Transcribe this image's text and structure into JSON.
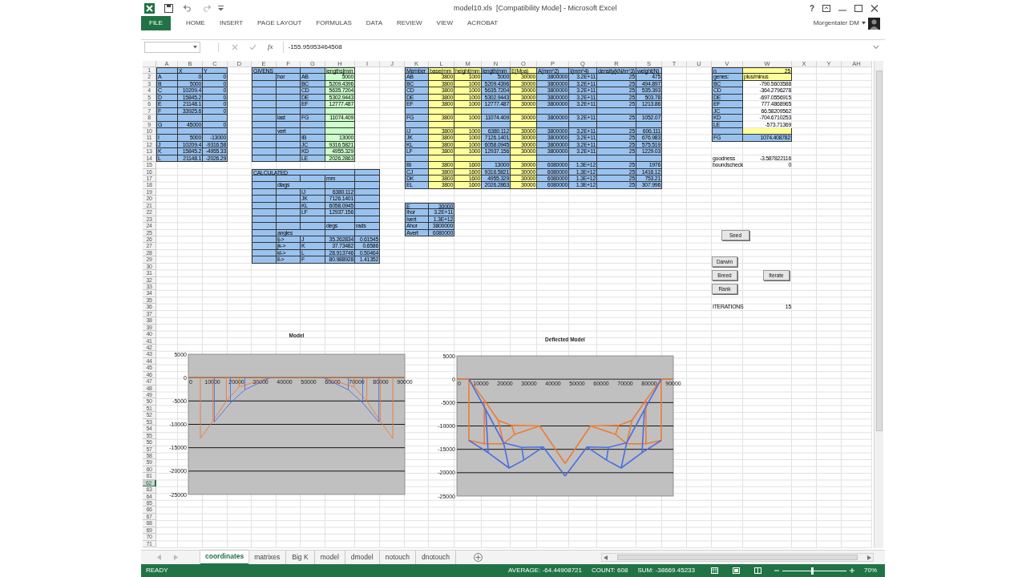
{
  "window": {
    "title": "model10.xls  [Compatibility Mode] - Microsoft Excel",
    "help": "?"
  },
  "ribbon": {
    "tabs": [
      {
        "label": "FILE",
        "kind": "file",
        "selected": false
      },
      {
        "label": "HOME",
        "kind": "tab",
        "selected": false
      },
      {
        "label": "INSERT",
        "kind": "tab",
        "selected": false
      },
      {
        "label": "PAGE LAYOUT",
        "kind": "tab",
        "selected": false
      },
      {
        "label": "FORMULAS",
        "kind": "tab",
        "selected": false
      },
      {
        "label": "DATA",
        "kind": "tab",
        "selected": false
      },
      {
        "label": "REVIEW",
        "kind": "tab",
        "selected": false
      },
      {
        "label": "VIEW",
        "kind": "tab",
        "selected": false
      },
      {
        "label": "ACROBAT",
        "kind": "tab",
        "selected": false
      }
    ],
    "user": "Morgentaler DM"
  },
  "formula_bar": {
    "function_label": "fx",
    "value": "-155.95953464508"
  },
  "sheet": {
    "columns": [
      "A",
      "B",
      "C",
      "D",
      "E",
      "F",
      "G",
      "H",
      "I",
      "J",
      "K",
      "L",
      "M",
      "N",
      "O",
      "P",
      "Q",
      "R",
      "S",
      "T",
      "U",
      "V",
      "W",
      "X",
      "Y",
      "AH"
    ],
    "rows": [
      {
        "label": "1",
        "selected": false
      },
      {
        "label": "2",
        "selected": false
      },
      {
        "label": "3",
        "selected": false
      },
      {
        "label": "4",
        "selected": false
      },
      {
        "label": "5",
        "selected": false
      },
      {
        "label": "6",
        "selected": false
      },
      {
        "label": "7",
        "selected": false
      },
      {
        "label": "8",
        "selected": false
      },
      {
        "label": "9",
        "selected": false
      },
      {
        "label": "10",
        "selected": false
      },
      {
        "label": "11",
        "selected": false
      },
      {
        "label": "12",
        "selected": false
      },
      {
        "label": "13",
        "selected": false
      },
      {
        "label": "14",
        "selected": false
      },
      {
        "label": "15",
        "selected": false
      },
      {
        "label": "16",
        "selected": false
      },
      {
        "label": "17",
        "selected": false
      },
      {
        "label": "18",
        "selected": false
      },
      {
        "label": "19",
        "selected": false
      },
      {
        "label": "20",
        "selected": false
      },
      {
        "label": "21",
        "selected": false
      },
      {
        "label": "22",
        "selected": false
      },
      {
        "label": "23",
        "selected": false
      },
      {
        "label": "24",
        "selected": false
      },
      {
        "label": "25",
        "selected": false
      },
      {
        "label": "26",
        "selected": false
      },
      {
        "label": "27",
        "selected": false
      },
      {
        "label": "28",
        "selected": false
      },
      {
        "label": "29",
        "selected": false
      },
      {
        "label": "30",
        "selected": false
      },
      {
        "label": "31",
        "selected": false
      },
      {
        "label": "32",
        "selected": false
      },
      {
        "label": "33",
        "selected": false
      },
      {
        "label": "34",
        "selected": false
      },
      {
        "label": "35",
        "selected": false
      },
      {
        "label": "36",
        "selected": false
      },
      {
        "label": "37",
        "selected": false
      },
      {
        "label": "38",
        "selected": false
      },
      {
        "label": "39",
        "selected": false
      },
      {
        "label": "40",
        "selected": false
      },
      {
        "label": "41",
        "selected": false
      },
      {
        "label": "42",
        "selected": false
      },
      {
        "label": "43",
        "selected": false
      },
      {
        "label": "44",
        "selected": false
      },
      {
        "label": "45",
        "selected": false
      },
      {
        "label": "46",
        "selected": false
      },
      {
        "label": "47",
        "selected": false
      },
      {
        "label": "48",
        "selected": false
      },
      {
        "label": "49",
        "selected": false
      },
      {
        "label": "50",
        "selected": false
      },
      {
        "label": "51",
        "selected": false
      },
      {
        "label": "52",
        "selected": false
      },
      {
        "label": "53",
        "selected": false
      },
      {
        "label": "54",
        "selected": false
      },
      {
        "label": "55",
        "selected": false
      },
      {
        "label": "56",
        "selected": false
      },
      {
        "label": "57",
        "selected": false
      },
      {
        "label": "58",
        "selected": false
      },
      {
        "label": "59",
        "selected": false
      },
      {
        "label": "60",
        "selected": false
      },
      {
        "label": "61",
        "selected": false
      },
      {
        "label": "62",
        "selected": true
      },
      {
        "label": "63",
        "selected": false
      },
      {
        "label": "64",
        "selected": false
      },
      {
        "label": "65",
        "selected": false
      },
      {
        "label": "66",
        "selected": false
      },
      {
        "label": "67",
        "selected": false
      },
      {
        "label": "68",
        "selected": false
      },
      {
        "label": "69",
        "selected": false
      },
      {
        "label": "70",
        "selected": false
      },
      {
        "label": "71",
        "selected": false
      }
    ],
    "blocks": [
      {
        "rows": [
          [
            "",
            {
              "text": "X",
              "kind": "label"
            },
            {
              "text": "Y",
              "kind": "label"
            }
          ],
          [
            "A",
            "0",
            "0"
          ],
          [
            "B",
            "5000",
            "0"
          ],
          [
            "C",
            "10209.4",
            "0"
          ],
          [
            "D",
            "15845.2",
            "0"
          ],
          [
            "E",
            "21148.1",
            "0"
          ],
          [
            "F",
            "33925.6",
            "0"
          ],
          [
            "",
            "",
            ""
          ],
          [
            "G",
            "45000",
            "0"
          ],
          [
            "",
            "",
            ""
          ],
          [
            "I",
            "5000",
            "-13000"
          ],
          [
            "J",
            "10209.4",
            "-9316.58"
          ],
          [
            "K",
            "15845.2",
            "-4955.33"
          ],
          [
            "L",
            "21148.1",
            "-2026.29"
          ]
        ]
      },
      {
        "rows": [
          [
            "GIVENS",
            "",
            "",
            {
              "text": "lengths[mm",
              "kind": "label"
            }
          ],
          [
            "",
            "hor",
            "AB",
            "5000"
          ],
          [
            "",
            "",
            "BC",
            "5209.4396"
          ],
          [
            "",
            "",
            "CD",
            "5635.7204"
          ],
          [
            "",
            "",
            "DE",
            "5302.9443"
          ],
          [
            "",
            "",
            "EF",
            "12777.487"
          ],
          [
            "",
            "",
            "",
            ""
          ],
          [
            "",
            "last",
            "FG",
            "11074.409"
          ],
          [
            "",
            "",
            "",
            ""
          ],
          [
            "",
            "vert",
            "",
            ""
          ],
          [
            "",
            "",
            "IB",
            "13000"
          ],
          [
            "",
            "",
            "JC",
            "9316.5821"
          ],
          [
            "",
            "",
            "KD",
            "4955.329"
          ],
          [
            "",
            "",
            "LE",
            "2026.2863"
          ]
        ]
      },
      {
        "rows": [
          [
            "CALCULATED",
            "",
            "",
            "",
            ""
          ],
          [
            "",
            "",
            "",
            {
              "text": "mm",
              "kind": "label"
            },
            ""
          ],
          [
            "",
            "diags",
            "",
            "",
            ""
          ],
          [
            "",
            "",
            "IJ",
            "6380.112",
            ""
          ],
          [
            "",
            "",
            "JK",
            "7126.1401",
            ""
          ],
          [
            "",
            "",
            "KL",
            "6058.0945",
            ""
          ],
          [
            "",
            "",
            "LF",
            "12937.156",
            ""
          ],
          [
            "",
            "",
            "",
            "",
            ""
          ],
          [
            "",
            "",
            "",
            {
              "text": "degs",
              "kind": "label"
            },
            {
              "text": "rads",
              "kind": "label"
            }
          ],
          [
            "",
            "angles",
            "",
            "",
            ""
          ],
          [
            "",
            "ij->",
            "J",
            "35.262834",
            "0.61545"
          ],
          [
            "",
            "jk->",
            "K",
            "37.73482",
            "0.6586"
          ],
          [
            "",
            "kl->",
            "L",
            "28.913746",
            "0.50464"
          ],
          [
            "",
            "ll->",
            "F",
            "80.988928",
            "1.41352"
          ]
        ]
      },
      {
        "rows": [
          [
            "Member",
            {
              "text": "base(mm",
              "kind": "label"
            },
            {
              "text": "height(mm",
              "kind": "label"
            },
            {
              "text": "length(mm",
              "kind": "label"
            },
            {
              "text": "E(Mpa)",
              "kind": "label"
            },
            {
              "text": "A(mm^2)",
              "kind": "label"
            },
            {
              "text": "I(mm^4)",
              "kind": "label"
            },
            {
              "text": "density(kN/m^3)",
              "kind": "label"
            },
            {
              "text": "weight(N)",
              "kind": "label"
            }
          ],
          [
            "AB",
            "3800",
            "1000",
            "5000",
            "30000",
            "3800000",
            "3.2E+11",
            "25",
            "475"
          ],
          [
            "BC",
            "3800",
            "1000",
            "5209.4396",
            "30000",
            "3800000",
            "3.2E+11",
            "25",
            "494.897"
          ],
          [
            "CD",
            "3800",
            "1000",
            "5635.7204",
            "30000",
            "3800000",
            "3.2E+11",
            "25",
            "535.393"
          ],
          [
            "DE",
            "3800",
            "1000",
            "5302.9443",
            "30000",
            "3800000",
            "3.2E+11",
            "25",
            "503.78"
          ],
          [
            "EF",
            "3800",
            "1000",
            "12777.487",
            "30000",
            "3800000",
            "3.2E+11",
            "25",
            "1213.86"
          ],
          [
            "",
            "",
            "",
            "",
            "",
            "",
            "",
            "",
            ""
          ],
          [
            "FG",
            "3800",
            "1000",
            "11074.409",
            "30000",
            "3800000",
            "3.2E+11",
            "25",
            "1052.07"
          ],
          [
            "",
            "",
            "",
            "",
            "",
            "",
            "",
            "",
            ""
          ],
          [
            "IJ",
            "3800",
            "1000",
            "6380.112",
            "30000",
            "3800000",
            "3.2E+11",
            "25",
            "606.111"
          ],
          [
            "JK",
            "3800",
            "1000",
            "7126.1401",
            "30000",
            "3800000",
            "3.2E+11",
            "25",
            "676.983"
          ],
          [
            "KL",
            "3800",
            "1000",
            "6058.0945",
            "30000",
            "3800000",
            "3.2E+11",
            "25",
            "575.519"
          ],
          [
            "LF",
            "3800",
            "1000",
            "12937.156",
            "30000",
            "3800000",
            "3.2E+11",
            "25",
            "1229.03"
          ],
          [
            "",
            "",
            "",
            "",
            "",
            "",
            "",
            "",
            ""
          ],
          [
            "BI",
            "3800",
            "1600",
            "13000",
            "30000",
            "6080000",
            "1.3E+12",
            "25",
            "1976"
          ],
          [
            "CJ",
            "3800",
            "1600",
            "9316.5821",
            "30000",
            "6080000",
            "1.3E+12",
            "25",
            "1416.12"
          ],
          [
            "DK",
            "3800",
            "1600",
            "4955.329",
            "30000",
            "6080000",
            "1.3E+12",
            "25",
            "753.21"
          ],
          [
            "EL",
            "3800",
            "1600",
            "2026.2863",
            "30000",
            "6080000",
            "1.3E+12",
            "25",
            "307.996"
          ]
        ]
      },
      {
        "rows": [
          [
            "E",
            "30000"
          ],
          [
            "Ihor",
            "3.2E+11"
          ],
          [
            "Ivert",
            "1.3E+12"
          ],
          [
            "Ahor",
            "3800000"
          ],
          [
            "Avert",
            "6080000"
          ]
        ]
      },
      {
        "rows": [
          [
            "n",
            {
              "text": "25",
              "color": "#ffff99"
            }
          ],
          [
            "genes:",
            {
              "text": "plus/minus",
              "color": "#ffff99",
              "kind": "label"
            }
          ],
          [
            "BC",
            "-790.5603588"
          ],
          [
            "CD",
            "-364.2796278"
          ],
          [
            "DE",
            "-697.0556915"
          ],
          [
            "EF",
            "777.4868965"
          ],
          [
            "JC",
            "66.58209562"
          ],
          [
            "KD",
            "-704.6710253"
          ],
          [
            "LE",
            "-573.71369"
          ],
          [
            "",
            {
              "text": "",
              "color": "#ffff99"
            }
          ],
          [
            "FG",
            {
              "text": "1074.408782",
              "color": "#99c2ef"
            }
          ]
        ]
      },
      {
        "rows": [
          [
            "goodness",
            "-3.587822116"
          ],
          [
            "boundscheck",
            "0"
          ]
        ]
      },
      {
        "rows": [
          [
            "ITERATIONS",
            "15"
          ]
        ]
      }
    ],
    "buttons": [
      {
        "label": "Seed"
      },
      {
        "label": "Darwin"
      },
      {
        "label": "Breed"
      },
      {
        "label": "Rank"
      },
      {
        "label": "Iterate"
      }
    ],
    "charts": [
      {
        "chart_data": {
          "type": "line",
          "title": "Model",
          "grid": true,
          "xlim": [
            0,
            90000
          ],
          "ylim": [
            -25000,
            5000
          ],
          "xticks": [
            0,
            10000,
            20000,
            30000,
            40000,
            50000,
            60000,
            70000,
            80000,
            90000
          ],
          "yticks": [
            5000,
            0,
            -5000,
            -10000,
            -15000,
            -20000,
            -25000
          ],
          "series": [
            {
              "color": "#ee7b30",
              "x": [
                0,
                90000
              ],
              "values": [
                0,
                0
              ]
            },
            {
              "color": "#ee7b30",
              "x": [
                5000,
                5000,
                10200,
                15800,
                21100,
                33900,
                null,
                10200,
                10200,
                null,
                15800,
                15800,
                null,
                21100,
                21100
              ],
              "values": [
                0,
                -13000,
                -9300,
                -5000,
                -2000,
                0,
                null,
                0,
                -9300,
                null,
                0,
                -5000,
                null,
                0,
                -2000
              ]
            },
            {
              "color": "#ee7b30",
              "x": [
                85000,
                85000,
                79800,
                74200,
                68900,
                56100,
                null,
                79800,
                79800,
                null,
                74200,
                74200,
                null,
                68900,
                68900
              ],
              "values": [
                0,
                -13000,
                -9300,
                -5000,
                -2000,
                0,
                null,
                0,
                -9300,
                null,
                0,
                -5000,
                null,
                0,
                -2000
              ]
            },
            {
              "color": "#4a6ee0",
              "x": [
                10800,
                17500,
                23500,
                34000,
                null,
                10800,
                10800,
                null,
                17500,
                17500,
                null,
                23500,
                23500
              ],
              "values": [
                -9500,
                -5400,
                -2600,
                0,
                null,
                0,
                -9500,
                null,
                0,
                -5400,
                null,
                0,
                -2600
              ]
            },
            {
              "color": "#4a6ee0",
              "x": [
                79200,
                72500,
                66500,
                56000,
                null,
                79200,
                79200,
                null,
                72500,
                72500,
                null,
                66500,
                66500
              ],
              "values": [
                -9500,
                -5400,
                -2600,
                0,
                null,
                0,
                -9500,
                null,
                0,
                -5400,
                null,
                0,
                -2600
              ]
            }
          ]
        }
      },
      {
        "chart_data": {
          "type": "line",
          "title": "Deflected Model",
          "grid": true,
          "xlim": [
            0,
            90000
          ],
          "ylim": [
            -25000,
            5000
          ],
          "xticks": [
            0,
            10000,
            20000,
            30000,
            40000,
            50000,
            60000,
            70000,
            80000,
            90000
          ],
          "yticks": [
            5000,
            0,
            -5000,
            -10000,
            -15000,
            -20000,
            -25000
          ],
          "series": [
            {
              "color": "#ee7b30",
              "x": [
                0,
                5000,
                11400,
                17200,
                22800,
                34400,
                45000,
                null,
                5000,
                5000,
                11400,
                19400,
                24000,
                34400,
                null,
                11400,
                11400,
                null,
                17200,
                19400,
                null,
                22800,
                24000
              ],
              "values": [
                0,
                0,
                -4500,
                -8800,
                -9900,
                -10000,
                -18000,
                null,
                0,
                -13100,
                -13800,
                -13800,
                -11800,
                -10000,
                null,
                -4500,
                -13800,
                null,
                -8800,
                -13800,
                null,
                -9900,
                -11800
              ]
            },
            {
              "color": "#ee7b30",
              "x": [
                90000,
                85000,
                78600,
                72800,
                67200,
                55600,
                45000,
                null,
                85000,
                85000,
                78600,
                70600,
                66000,
                55600,
                null,
                78600,
                78600,
                null,
                72800,
                70600,
                null,
                67200,
                66000
              ],
              "values": [
                0,
                0,
                -4500,
                -8800,
                -9900,
                -10000,
                -18000,
                null,
                0,
                -13100,
                -13800,
                -13800,
                -11800,
                -10000,
                null,
                -4500,
                -13800,
                null,
                -8800,
                -13800,
                null,
                -9900,
                -11800
              ]
            },
            {
              "color": "#4a6ee0",
              "x": [
                5000,
                12000,
                19400,
                27000,
                35900,
                45000,
                null,
                5000,
                13000,
                21700,
                27800,
                35900,
                null,
                12000,
                13000,
                null,
                19400,
                21700,
                null,
                27000,
                27800
              ],
              "values": [
                0,
                -6500,
                -13600,
                -14600,
                -14500,
                -20700,
                null,
                -13100,
                -15700,
                -19000,
                -17300,
                -14500,
                null,
                -6500,
                -15700,
                null,
                -13600,
                -19000,
                null,
                -14600,
                -17300
              ]
            },
            {
              "color": "#4a6ee0",
              "x": [
                85000,
                78000,
                70600,
                63000,
                54100,
                45000,
                null,
                85000,
                77000,
                68300,
                62200,
                54100,
                null,
                78000,
                77000,
                null,
                70600,
                68300,
                null,
                63000,
                62200
              ],
              "values": [
                0,
                -6500,
                -13600,
                -14600,
                -14500,
                -20700,
                null,
                -13100,
                -15700,
                -19000,
                -17300,
                -14500,
                null,
                -6500,
                -15700,
                null,
                -13600,
                -19000,
                null,
                -14600,
                -17300
              ]
            }
          ]
        }
      }
    ]
  },
  "sheet_tabs": [
    {
      "label": "coordinates",
      "selected": true
    },
    {
      "label": "matrixes",
      "selected": false
    },
    {
      "label": "Big K",
      "selected": false
    },
    {
      "label": "model",
      "selected": false
    },
    {
      "label": "dmodel",
      "selected": false
    },
    {
      "label": "notouch",
      "selected": false
    },
    {
      "label": "dnotouch",
      "selected": false
    }
  ],
  "status_bar": {
    "mode": "READY",
    "average": "AVERAGE: -64.44908721",
    "count": "COUNT: 608",
    "sum": "SUM: -38669.45233",
    "zoom": "70%",
    "zoom_slider": {
      "level": 0.45
    }
  }
}
